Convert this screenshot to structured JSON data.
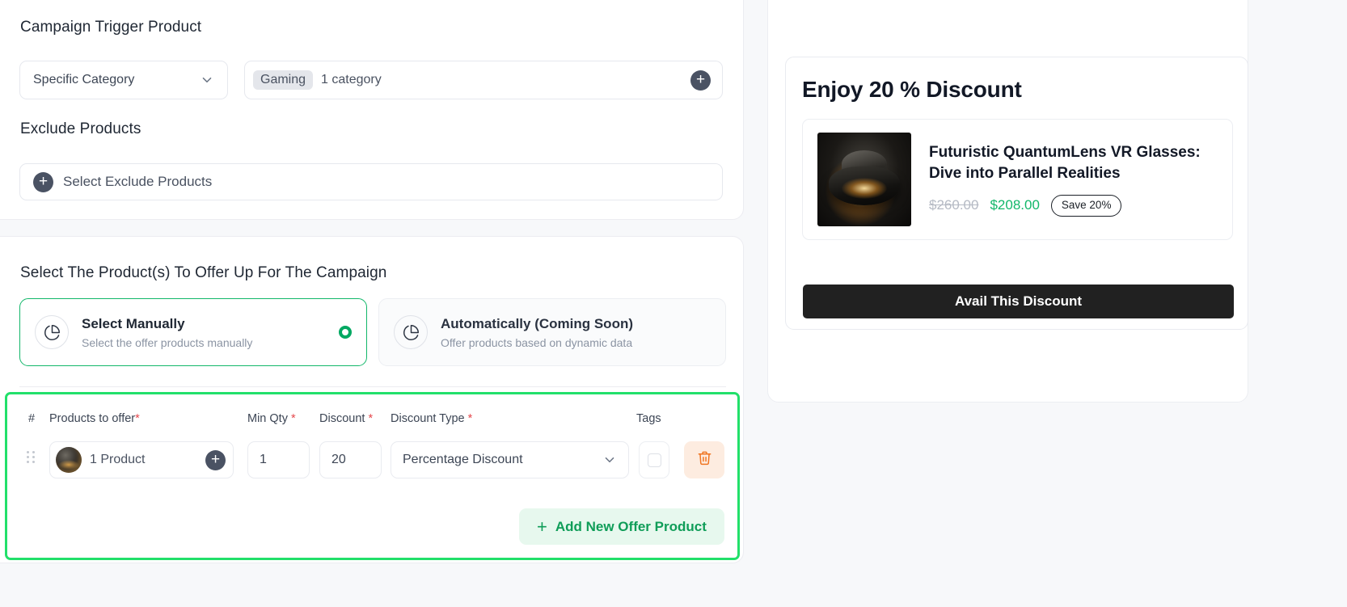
{
  "trigger_section": {
    "title": "Campaign Trigger Product",
    "category_select": {
      "value": "Specific Category",
      "icon": "chevron-down-icon"
    },
    "category_field": {
      "chip": "Gaming",
      "summary": "1 category",
      "add_icon": "plus-circle-icon"
    },
    "exclude_title": "Exclude Products",
    "exclude_field": {
      "placeholder": "Select Exclude Products",
      "add_icon": "plus-circle-icon"
    }
  },
  "offer_section": {
    "title": "Select The Product(s) To Offer Up For The Campaign",
    "options": [
      {
        "title": "Select Manually",
        "subtitle": "Select the offer products manually",
        "icon": "pie-chart-icon",
        "selected": true
      },
      {
        "title": "Automatically (Coming Soon)",
        "subtitle": "Offer products based on dynamic data",
        "icon": "pie-chart-icon",
        "selected": false
      }
    ],
    "table": {
      "headers": {
        "index": "#",
        "products": "Products to offer",
        "min_qty": "Min Qty",
        "discount": "Discount",
        "discount_type": "Discount Type",
        "tags": "Tags",
        "required_marker": "*"
      },
      "rows": [
        {
          "drag_icon": "drag-handle-icon",
          "product_label": "1 Product",
          "product_add_icon": "plus-circle-icon",
          "min_qty": "1",
          "discount": "20",
          "discount_type": "Percentage Discount",
          "discount_type_icon": "chevron-down-icon",
          "tags_checkbox": "",
          "delete_icon": "trash-icon"
        }
      ],
      "add_button": {
        "label": "Add New Offer Product",
        "icon": "plus-icon"
      }
    }
  },
  "preview": {
    "headline": "Enjoy 20 % Discount",
    "product": {
      "name": "Futuristic QuantumLens VR Glasses: Dive into Parallel Realities",
      "image_alt": "vr-glasses-thumbnail",
      "price_original": "$260.00",
      "price_discounted": "$208.00",
      "save_badge": "Save 20%"
    },
    "cta": "Avail This Discount"
  },
  "colors": {
    "accent_green": "#12b76a",
    "highlight_green": "#22e06a",
    "radio_green": "#00a862",
    "required_red": "#e5484d",
    "trash_orange": "#f07521",
    "cta_dark": "#212121",
    "page_bg": "#f7f8fa"
  }
}
